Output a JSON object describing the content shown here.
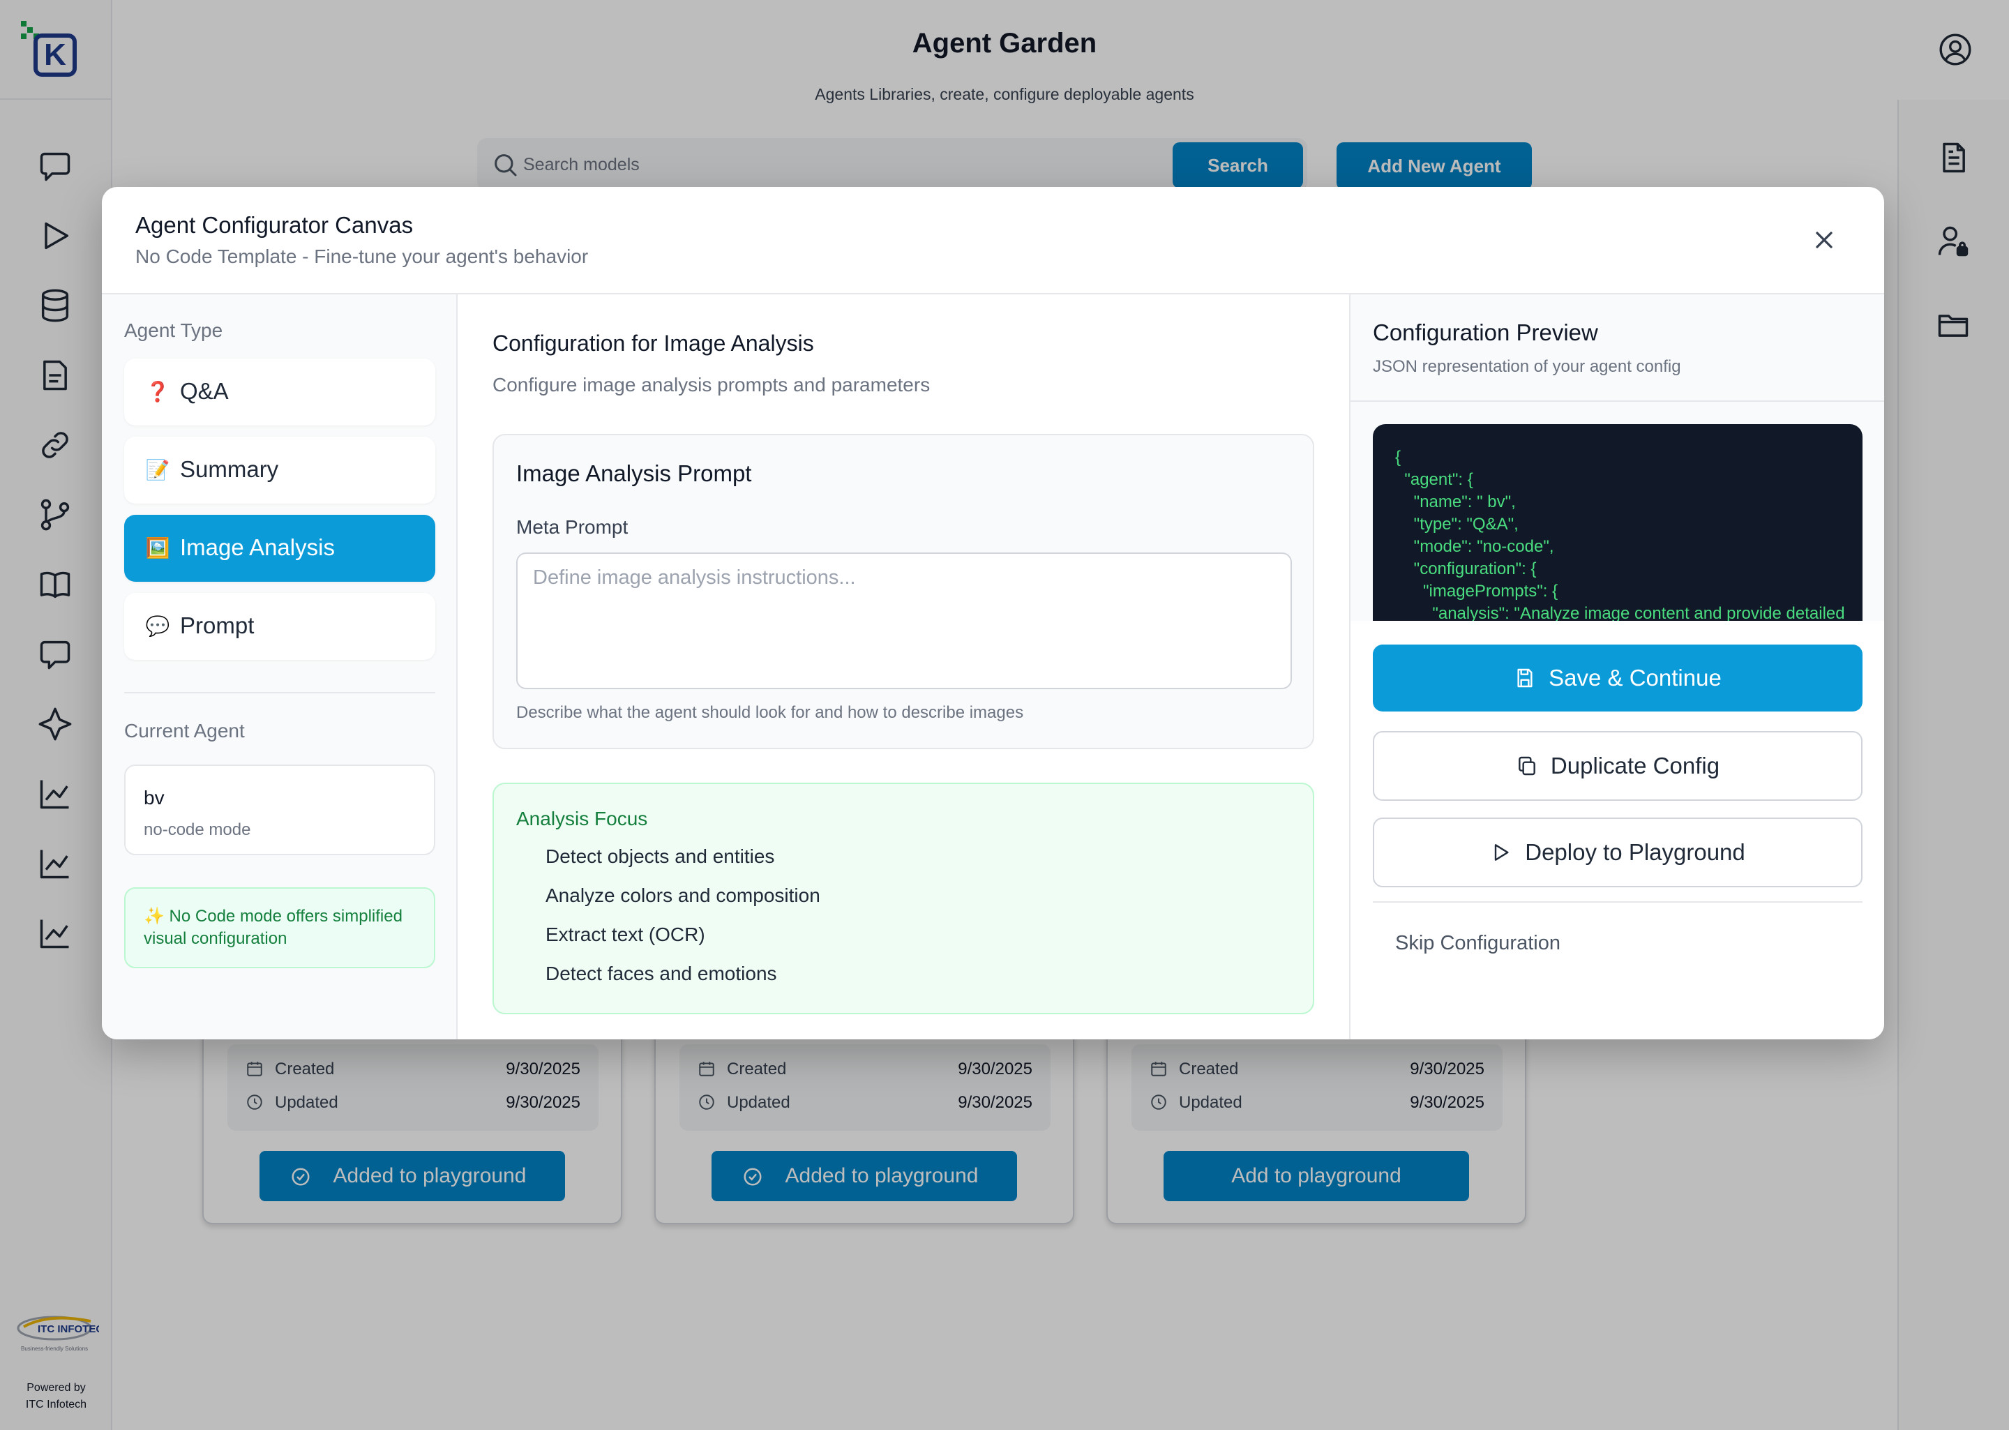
{
  "app": {
    "title": "Agent Garden",
    "subtitle": "Agents Libraries, create, configure deployable agents",
    "search": {
      "placeholder": "Search models",
      "button_label": "Search"
    },
    "add_agent_label": "Add New Agent",
    "footer": {
      "line1": "Powered by",
      "line2": "ITC Infotech"
    },
    "left_rail_icons": [
      "chat-icon",
      "play-icon",
      "database-icon",
      "document-icon",
      "link-icon",
      "branch-icon",
      "book-icon",
      "message-icon",
      "sparkle-icon",
      "chart-icon",
      "chart-icon",
      "chart-icon"
    ],
    "right_rail_icons": [
      "file-text-icon",
      "user-lock-icon",
      "folder-icon"
    ]
  },
  "cards": [
    {
      "created_label": "Created",
      "created": "9/30/2025",
      "updated_label": "Updated",
      "updated": "9/30/2025",
      "button_label": "Added to playground",
      "added": true
    },
    {
      "created_label": "Created",
      "created": "9/30/2025",
      "updated_label": "Updated",
      "updated": "9/30/2025",
      "button_label": "Added to playground",
      "added": true
    },
    {
      "created_label": "Created",
      "created": "9/30/2025",
      "updated_label": "Updated",
      "updated": "9/30/2025",
      "button_label": "Add to playground",
      "added": false
    }
  ],
  "modal": {
    "title": "Agent Configurator Canvas",
    "subtitle": "No Code Template - Fine-tune your agent's behavior",
    "agent_type_label": "Agent Type",
    "agent_types": [
      {
        "emoji": "❓",
        "label": "Q&A",
        "active": false
      },
      {
        "emoji": "📝",
        "label": "Summary",
        "active": false
      },
      {
        "emoji": "🖼️",
        "label": "Image Analysis",
        "active": true
      },
      {
        "emoji": "💬",
        "label": "Prompt",
        "active": false
      }
    ],
    "current_agent_label": "Current Agent",
    "current_agent": {
      "name": "bv",
      "mode": "no-code mode"
    },
    "nocode_note": "✨ No Code mode offers simplified visual configuration",
    "config": {
      "title": "Configuration for Image Analysis",
      "subtitle": "Configure image analysis prompts and parameters",
      "prompt_card": {
        "title": "Image Analysis Prompt",
        "field_label": "Meta Prompt",
        "placeholder": "Define image analysis instructions...",
        "value": "",
        "help": "Describe what the agent should look for and how to describe images"
      },
      "focus": {
        "title": "Analysis Focus",
        "items": [
          "Detect objects and entities",
          "Analyze colors and composition",
          "Extract text (OCR)",
          "Detect faces and emotions"
        ]
      }
    },
    "preview": {
      "title": "Configuration Preview",
      "subtitle": "JSON representation of your agent config",
      "json_text": "{\n  \"agent\": {\n    \"name\": \" bv\",\n    \"type\": \"Q&A\",\n    \"mode\": \"no-code\",\n    \"configuration\": {\n      \"imagePrompts\": {\n        \"analysis\": \"Analyze image content and provide detailed"
    },
    "actions": {
      "save_label": "Save & Continue",
      "duplicate_label": "Duplicate Config",
      "deploy_label": "Deploy to Playground",
      "skip_label": "Skip Configuration"
    }
  },
  "colors": {
    "primary": "#0284c7",
    "active_tab": "#0b9bd9",
    "code_bg": "#111827",
    "code_text": "#4ade80",
    "note_green": "#15803d"
  }
}
